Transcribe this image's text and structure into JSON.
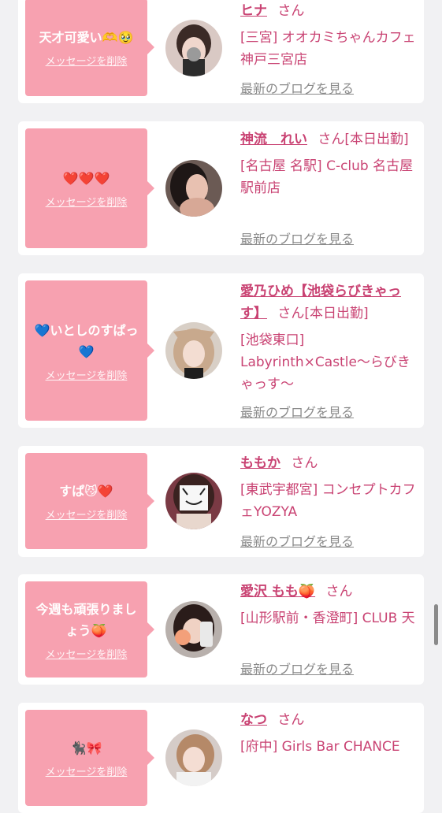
{
  "colors": {
    "accent": "#c94373",
    "bubble": "#f7a1b0",
    "link_gray": "#8a8a8a"
  },
  "delete_label": "メッセージを削除",
  "blog_label": "最新のブログを見る",
  "suffix": "さん",
  "cards": [
    {
      "message": "天才可愛い🫶🥹",
      "name": "ヒナ",
      "suffix": "さん",
      "shop": "[三宮] オオカミちゃんカフェ神戸三宮店"
    },
    {
      "message": "❤️❤️❤️",
      "name": "神流　れい",
      "suffix": "さん[本日出勤]",
      "shop": "[名古屋 名駅] C-club 名古屋駅前店"
    },
    {
      "message": "💙いとしのすぱっ💙",
      "name": "愛乃ひめ【池袋らびきゃっす】",
      "suffix": "さん[本日出勤]",
      "shop": "[池袋東口] Labyrinth×Castle～らびきゃっす～"
    },
    {
      "message": "すぱ😼❤️",
      "name": "ももか",
      "suffix": "さん",
      "shop": "[東武宇都宮] コンセプトカフェYOZYA"
    },
    {
      "message": "今週も頑張りましょう🍑",
      "name": "愛沢 もも🍑",
      "suffix": "さん",
      "shop": "[山形駅前・香澄町] CLUB 天"
    },
    {
      "message": "🐈‍⬛🎀",
      "name": "なつ",
      "suffix": "さん",
      "shop": "[府中] Girls Bar CHANCE"
    }
  ]
}
